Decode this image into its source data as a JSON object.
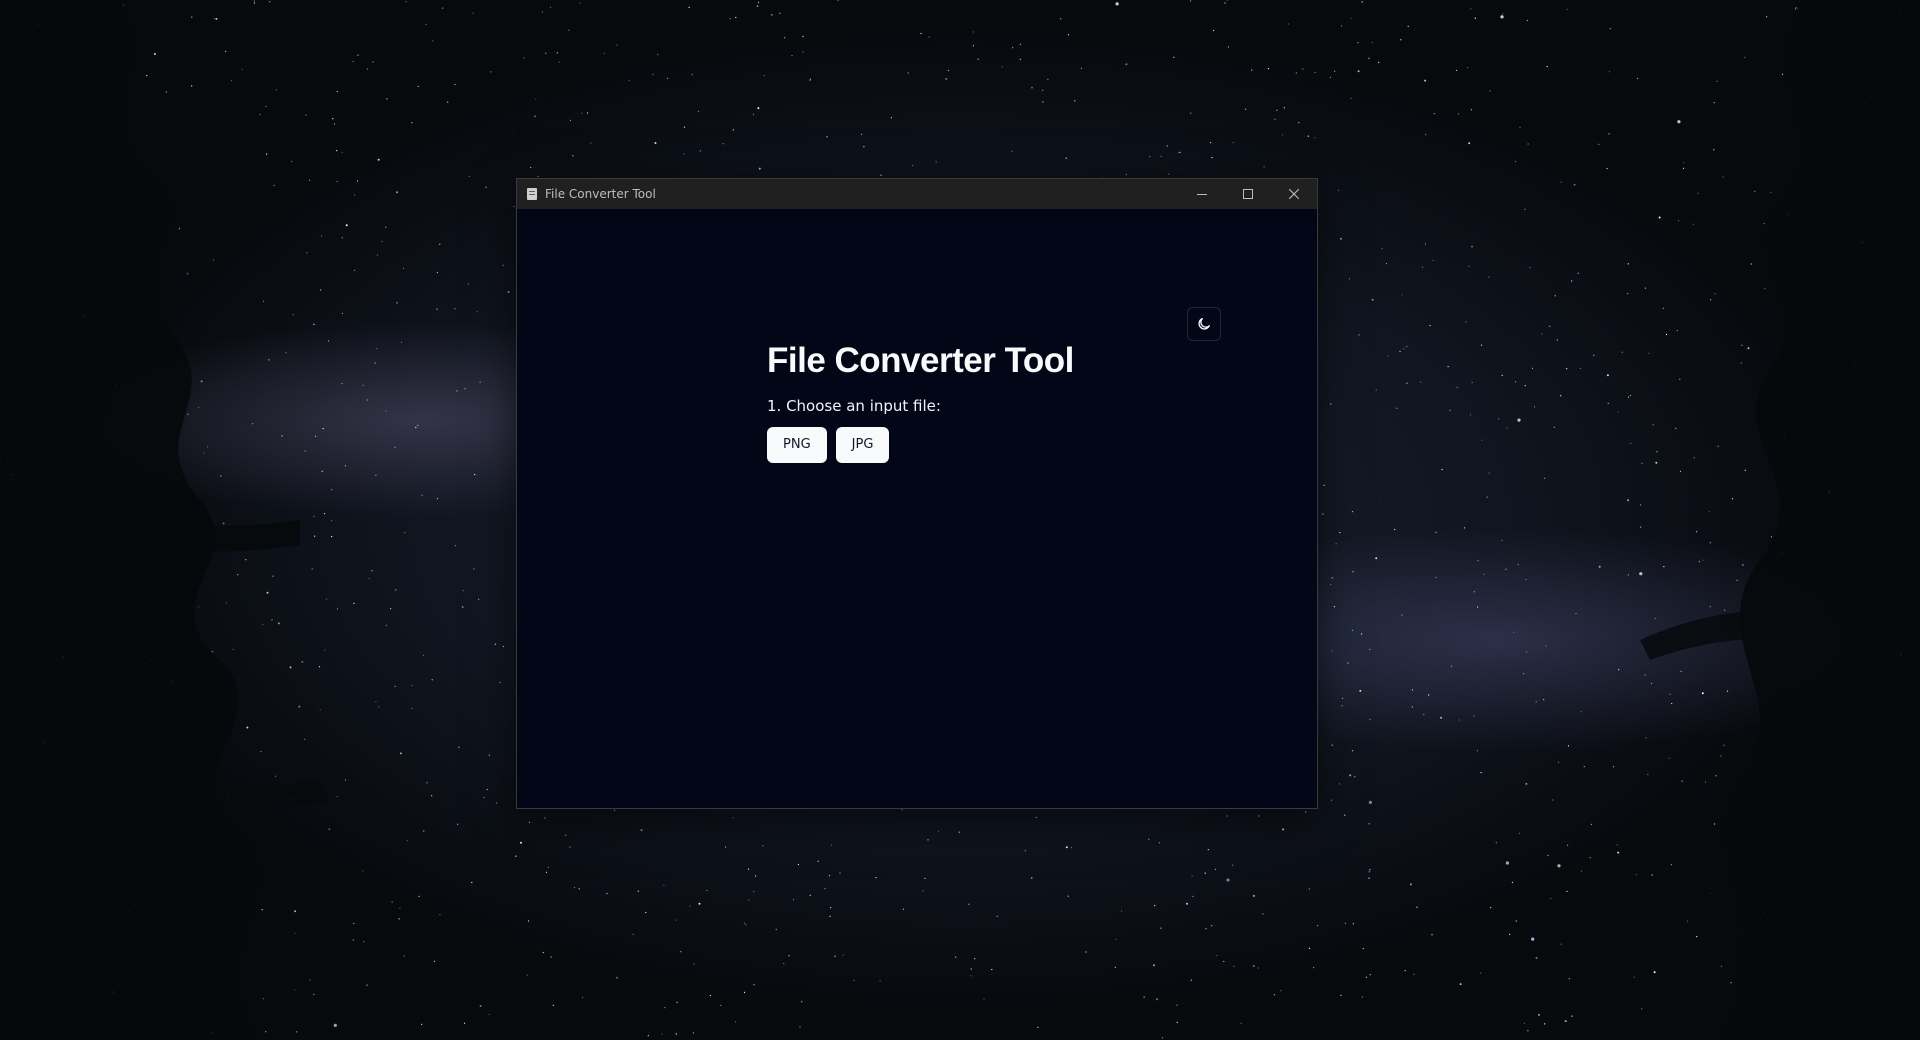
{
  "window": {
    "title": "File Converter Tool",
    "controls": {
      "minimize_icon": "minimize-icon",
      "maximize_icon": "maximize-icon",
      "close_icon": "close-icon"
    }
  },
  "app": {
    "title": "File Converter Tool",
    "step1_label": "1. Choose an input file:",
    "formats": [
      "PNG",
      "JPG"
    ],
    "theme_toggle_icon": "moon-icon"
  },
  "colors": {
    "window_bg": "#020617",
    "titlebar_bg": "#202020",
    "button_bg": "#f8fafc",
    "button_text": "#0f172a",
    "title_text": "#f8fafc"
  }
}
